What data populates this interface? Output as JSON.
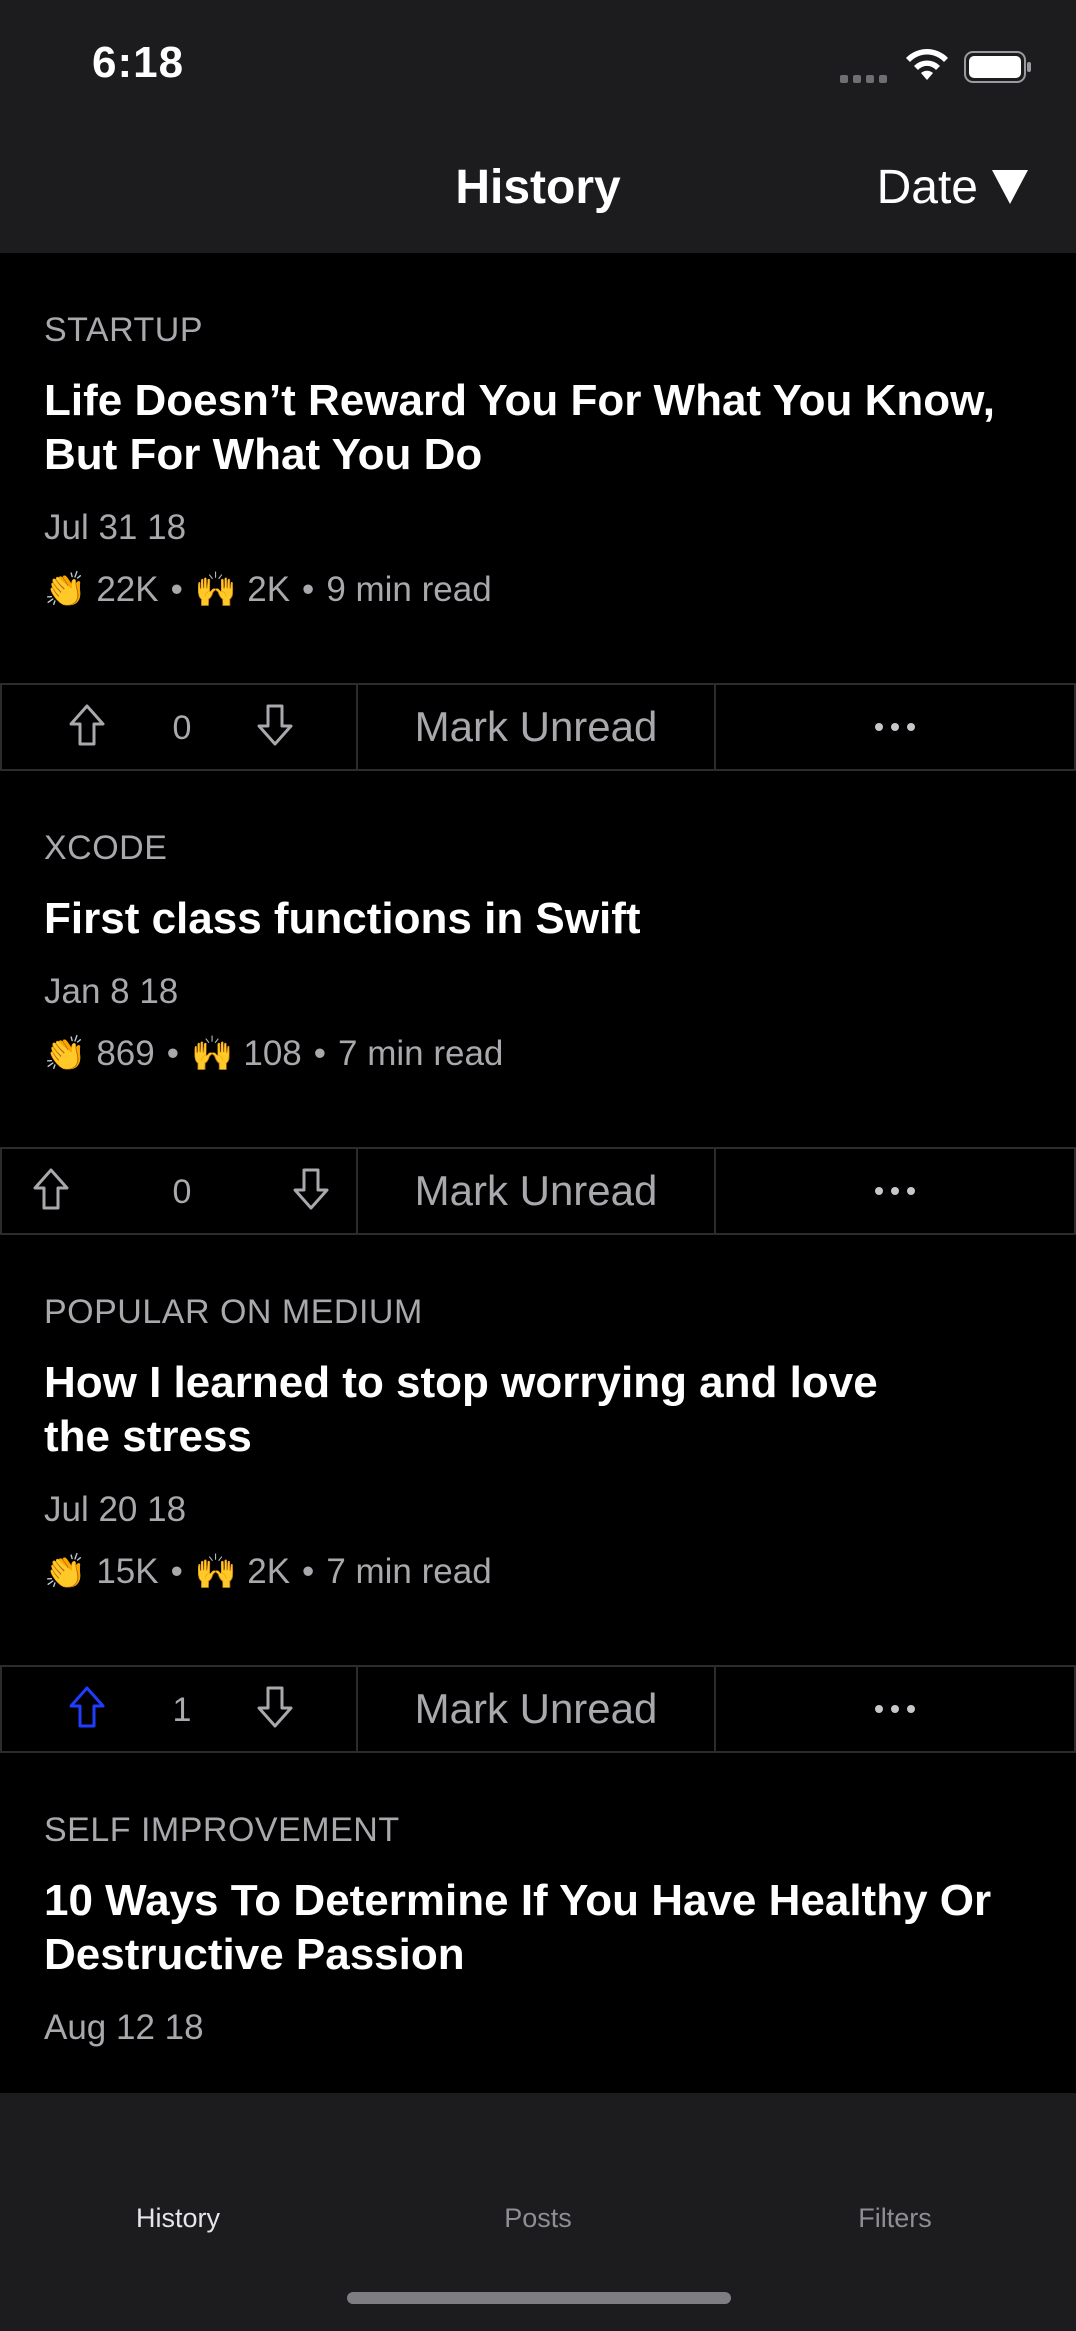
{
  "status_bar": {
    "time": "6:18"
  },
  "nav": {
    "title": "History",
    "sort_label": "Date"
  },
  "posts": [
    {
      "category": "STARTUP",
      "title": "Life Doesn’t Reward You For What You Know, But For What You Do",
      "date": "Jul 31 18",
      "claps": "22K",
      "highfives": "2K",
      "read_time": "9 min read",
      "votes": "0",
      "upvote_active": false,
      "mark_label": "Mark Unread"
    },
    {
      "category": "XCODE",
      "title": "First class functions in Swift",
      "date": "Jan 8 18",
      "claps": "869",
      "highfives": "108",
      "read_time": "7 min read",
      "votes": "0",
      "upvote_active": false,
      "mark_label": "Mark Unread"
    },
    {
      "category": "POPULAR ON MEDIUM",
      "title": "How I learned to stop worrying and love the stress",
      "date": "Jul 20 18",
      "claps": "15K",
      "highfives": "2K",
      "read_time": "7 min read",
      "votes": "1",
      "upvote_active": true,
      "mark_label": "Mark Unread"
    },
    {
      "category": "SELF IMPROVEMENT",
      "title": "10 Ways To Determine If You Have Healthy Or Destructive Passion",
      "date": "Aug 12 18"
    }
  ],
  "tabs": [
    {
      "label": "History",
      "active": true
    },
    {
      "label": "Posts",
      "active": false
    },
    {
      "label": "Filters",
      "active": false
    }
  ],
  "colors": {
    "background": "#000000",
    "bar": "#1c1c1e",
    "upvote_active": "#1f3cff",
    "muted_text": "#a8a8ad"
  },
  "icons": {
    "clap": "clapping-hands-icon",
    "highfive": "raised-hands-icon",
    "upvote": "arrow-up-outline-icon",
    "downvote": "arrow-down-outline-icon",
    "more": "ellipsis-icon"
  }
}
